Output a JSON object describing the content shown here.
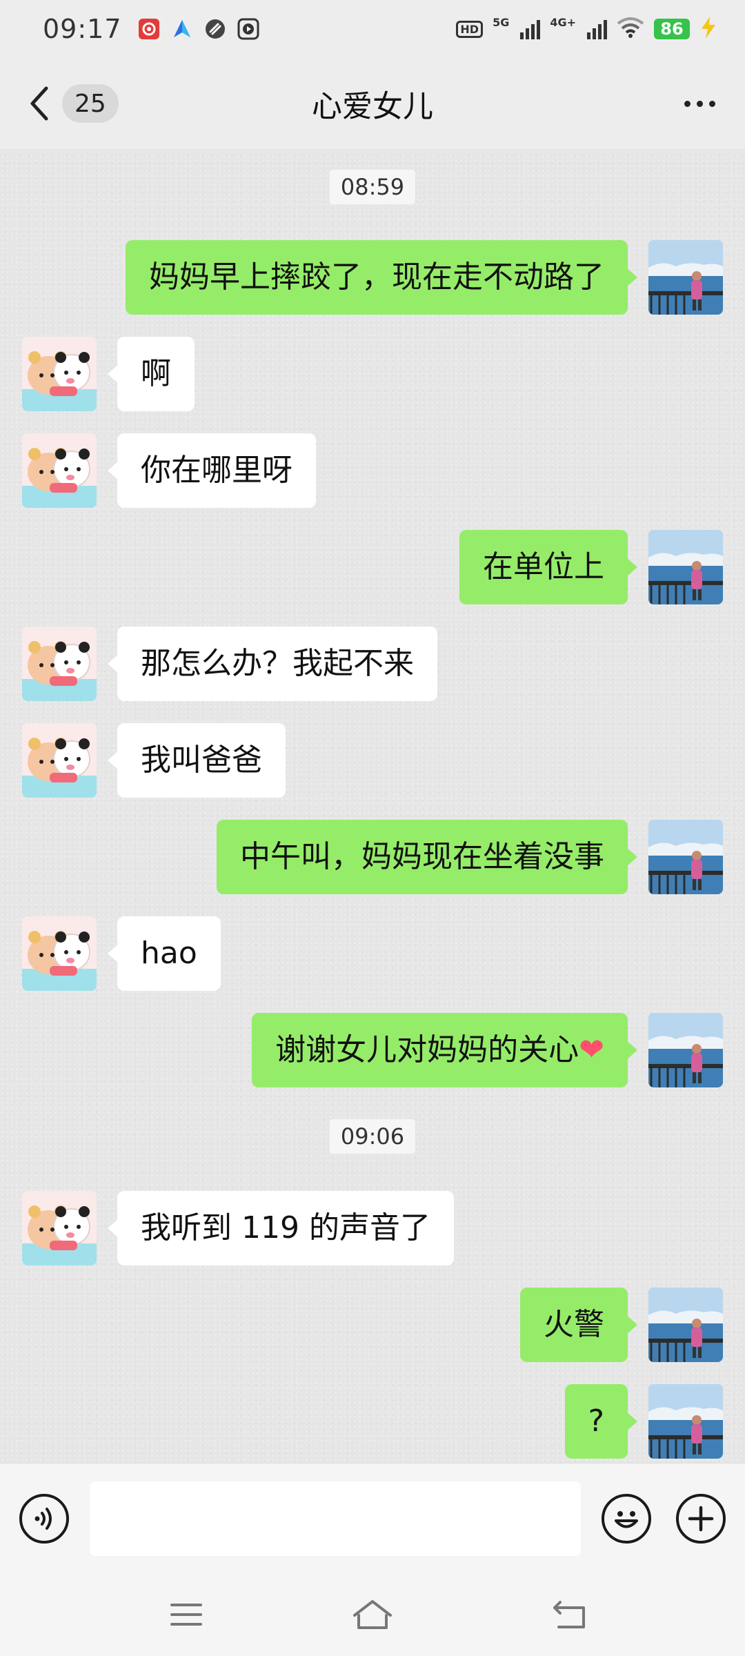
{
  "status_bar": {
    "time": "09:17",
    "network_1": "5G",
    "network_2": "4G+",
    "hd_label": "HD",
    "battery": "86",
    "notification_icons": [
      "app-notification-icon",
      "navigation-icon",
      "link-icon",
      "video-play-icon"
    ]
  },
  "header": {
    "unread_count": "25",
    "title": "心爱女儿"
  },
  "timestamps": [
    "08:59",
    "09:06"
  ],
  "messages": [
    {
      "side": "right",
      "text": "妈妈早上摔跤了，现在走不动路了"
    },
    {
      "side": "left",
      "text": "啊"
    },
    {
      "side": "left",
      "text": "你在哪里呀"
    },
    {
      "side": "right",
      "text": "在单位上"
    },
    {
      "side": "left",
      "text": "那怎么办？我起不来"
    },
    {
      "side": "left",
      "text": "我叫爸爸"
    },
    {
      "side": "right",
      "text": "中午叫，妈妈现在坐着没事"
    },
    {
      "side": "left",
      "text": "hao"
    },
    {
      "side": "right",
      "text": "谢谢女儿对妈妈的关心",
      "emoji": "❤"
    },
    {
      "side": "left",
      "text": "我听到 119 的声音了"
    },
    {
      "side": "right",
      "text": "火警"
    },
    {
      "side": "right",
      "text": "?"
    }
  ],
  "input_bar": {
    "text_value": "",
    "placeholder": ""
  },
  "colors": {
    "outgoing_bubble": "#95ec69",
    "incoming_bubble": "#ffffff",
    "battery": "#37c24b",
    "background": "#ededed"
  }
}
